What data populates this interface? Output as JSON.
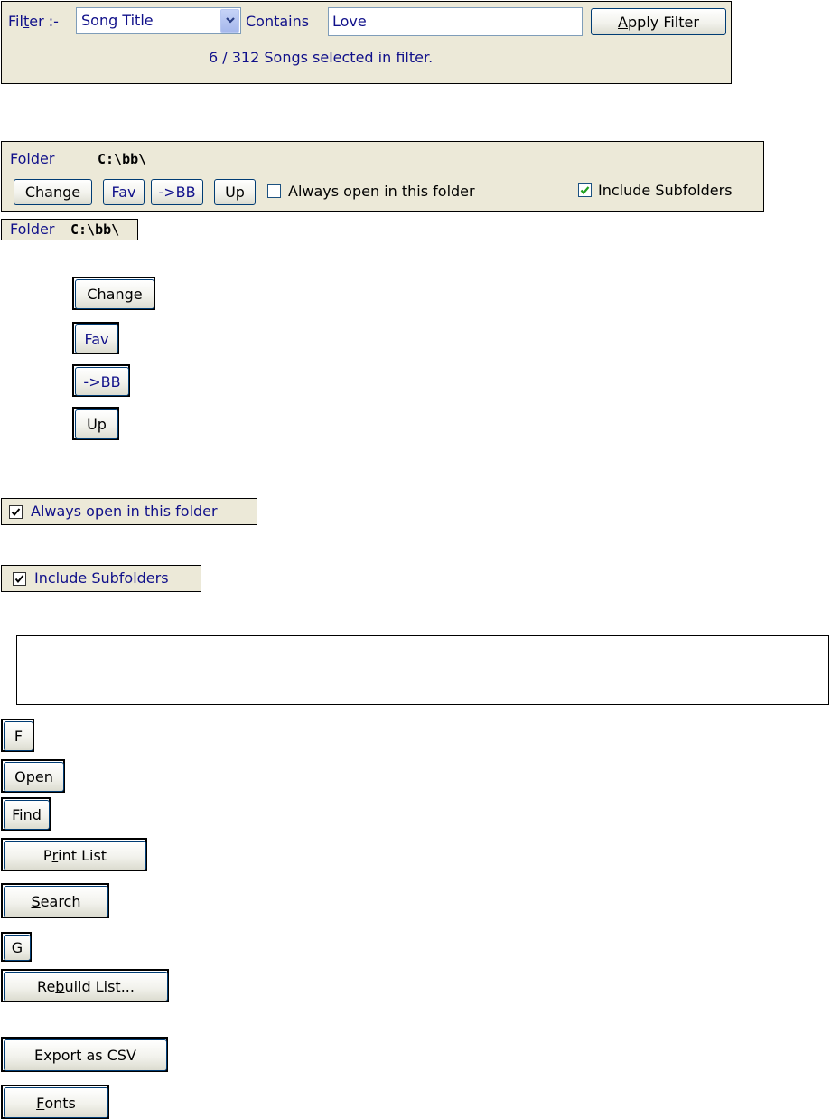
{
  "filter": {
    "label_pre": "Fil",
    "label_underlined": "t",
    "label_post": "er :-",
    "field": "Song Title",
    "contains_label": "Contains",
    "value": "Love",
    "apply_pre": "",
    "apply_underlined": "A",
    "apply_post": "pply Filter",
    "status": "6 / 312 Songs selected in filter."
  },
  "folder_panel": {
    "label": "Folder",
    "path": "C:\\bb\\",
    "change": "Change",
    "fav": "Fav",
    "to_bb": "->BB",
    "up": "Up",
    "always_open": "Always open in this folder",
    "include_sub": "Include Subfolders"
  },
  "folder_small": {
    "label": "Folder",
    "path": "C:\\bb\\"
  },
  "buttons": {
    "change": "Change",
    "fav": "Fav",
    "to_bb": "->BB",
    "up": "Up"
  },
  "checkboxes": {
    "always_open": "Always open in this folder",
    "include_sub": "Include Subfolders"
  },
  "bottom_buttons": {
    "f": "F",
    "open": "Open",
    "find": "Find",
    "print_pre": "P",
    "print_u": "r",
    "print_post": "int List",
    "search_pre": "",
    "search_u": "S",
    "search_post": "earch",
    "g_u": "G",
    "rebuild_pre": "Re",
    "rebuild_u": "b",
    "rebuild_post": "uild List...",
    "export": "Export as CSV",
    "fonts_pre": "",
    "fonts_u": "F",
    "fonts_post": "onts"
  },
  "colors": {
    "panel": "#ECE9D8",
    "label_blue": "#10108a",
    "check_green": "#21a121"
  }
}
